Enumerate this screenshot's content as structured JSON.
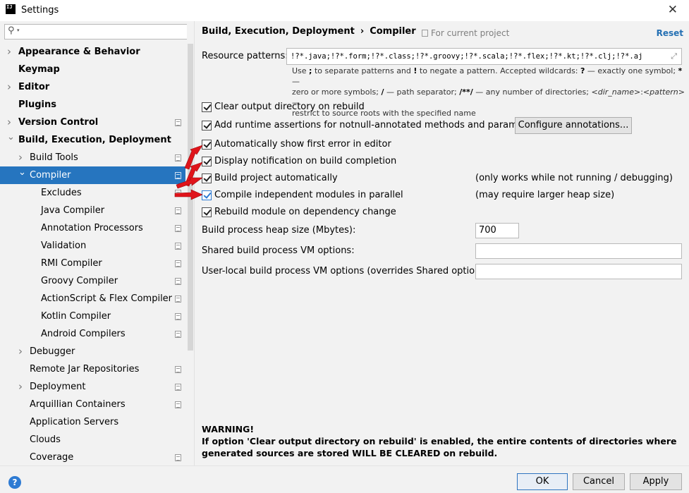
{
  "window": {
    "title": "Settings",
    "app_icon_text": "IJ",
    "close_glyph": "✕"
  },
  "sidebar": {
    "search": {
      "value": "",
      "placeholder": ""
    },
    "items": [
      {
        "label": "Appearance & Behavior",
        "level": 0,
        "arrow": "right",
        "bold": true,
        "project": false
      },
      {
        "label": "Keymap",
        "level": 0,
        "arrow": "none",
        "bold": true,
        "project": false
      },
      {
        "label": "Editor",
        "level": 0,
        "arrow": "right",
        "bold": true,
        "project": false
      },
      {
        "label": "Plugins",
        "level": 0,
        "arrow": "none",
        "bold": true,
        "project": false
      },
      {
        "label": "Version Control",
        "level": 0,
        "arrow": "right",
        "bold": true,
        "project": true
      },
      {
        "label": "Build, Execution, Deployment",
        "level": 0,
        "arrow": "down",
        "bold": true,
        "project": false
      },
      {
        "label": "Build Tools",
        "level": 1,
        "arrow": "right",
        "bold": false,
        "project": true
      },
      {
        "label": "Compiler",
        "level": 1,
        "arrow": "down",
        "bold": false,
        "project": true,
        "selected": true
      },
      {
        "label": "Excludes",
        "level": 2,
        "arrow": "none",
        "bold": false,
        "project": true
      },
      {
        "label": "Java Compiler",
        "level": 2,
        "arrow": "none",
        "bold": false,
        "project": true
      },
      {
        "label": "Annotation Processors",
        "level": 2,
        "arrow": "none",
        "bold": false,
        "project": true
      },
      {
        "label": "Validation",
        "level": 2,
        "arrow": "none",
        "bold": false,
        "project": true
      },
      {
        "label": "RMI Compiler",
        "level": 2,
        "arrow": "none",
        "bold": false,
        "project": true
      },
      {
        "label": "Groovy Compiler",
        "level": 2,
        "arrow": "none",
        "bold": false,
        "project": true
      },
      {
        "label": "ActionScript & Flex Compiler",
        "level": 2,
        "arrow": "none",
        "bold": false,
        "project": true
      },
      {
        "label": "Kotlin Compiler",
        "level": 2,
        "arrow": "none",
        "bold": false,
        "project": true
      },
      {
        "label": "Android Compilers",
        "level": 2,
        "arrow": "none",
        "bold": false,
        "project": true
      },
      {
        "label": "Debugger",
        "level": 1,
        "arrow": "right",
        "bold": false,
        "project": false
      },
      {
        "label": "Remote Jar Repositories",
        "level": 1,
        "arrow": "none",
        "bold": false,
        "project": true
      },
      {
        "label": "Deployment",
        "level": 1,
        "arrow": "right",
        "bold": false,
        "project": true
      },
      {
        "label": "Arquillian Containers",
        "level": 1,
        "arrow": "none",
        "bold": false,
        "project": true
      },
      {
        "label": "Application Servers",
        "level": 1,
        "arrow": "none",
        "bold": false,
        "project": false
      },
      {
        "label": "Clouds",
        "level": 1,
        "arrow": "none",
        "bold": false,
        "project": false
      },
      {
        "label": "Coverage",
        "level": 1,
        "arrow": "none",
        "bold": false,
        "project": true
      }
    ]
  },
  "main": {
    "breadcrumb": {
      "parent": "Build, Execution, Deployment",
      "separator": "›",
      "current": "Compiler"
    },
    "for_current_project": "For current project",
    "reset": "Reset",
    "resource_patterns": {
      "label": "Resource patterns:",
      "value": "!?*.java;!?*.form;!?*.class;!?*.groovy;!?*.scala;!?*.flex;!?*.kt;!?*.clj;!?*.aj",
      "expand_glyph": "⤢"
    },
    "hint": {
      "line1_a": "Use ",
      "semicolon": ";",
      "line1_b": " to separate patterns and ",
      "bang": "!",
      "line1_c": " to negate a pattern. Accepted wildcards: ",
      "q": "?",
      "line1_d": " — exactly one symbol; ",
      "star": "*",
      "line1_e": " —",
      "line2_a": "zero or more symbols; ",
      "slash": "/",
      "line2_b": " — path separator; ",
      "dstar": "/**/",
      "line2_c": " — any number of directories; ",
      "dir_name": "<dir_name>",
      "colon": ":",
      "pattern": "<pattern>",
      "line2_d": " —",
      "line3": "restrict to source roots with the specified name"
    },
    "options": {
      "clear_output": "Clear output directory on rebuild",
      "runtime_assertions": "Add runtime assertions for notnull-annotated methods and parameters",
      "configure_annotations": "Configure annotations...",
      "show_first_error": "Automatically show first error in editor",
      "display_notification": "Display notification on build completion",
      "build_automatically": "Build project automatically",
      "build_automatically_note": "(only works while not running / debugging)",
      "compile_parallel": "Compile independent modules in parallel",
      "compile_parallel_note": "(may require larger heap size)",
      "rebuild_on_dependency": "Rebuild module on dependency change"
    },
    "heap_size": {
      "label": "Build process heap size (Mbytes):",
      "value": "700"
    },
    "shared_vm": {
      "label": "Shared build process VM options:",
      "value": ""
    },
    "user_vm": {
      "label": "User-local build process VM options (overrides Shared options):",
      "value": ""
    },
    "warning": {
      "title": "WARNING!",
      "text": "If option 'Clear output directory on rebuild' is enabled, the entire contents of directories where generated sources are stored WILL BE CLEARED on rebuild."
    }
  },
  "footer": {
    "help_glyph": "?",
    "ok": "OK",
    "cancel": "Cancel",
    "apply": "Apply"
  },
  "colors": {
    "selection": "#2675bf",
    "link": "#2470b3",
    "annotation_arrow": "#e0141b"
  }
}
